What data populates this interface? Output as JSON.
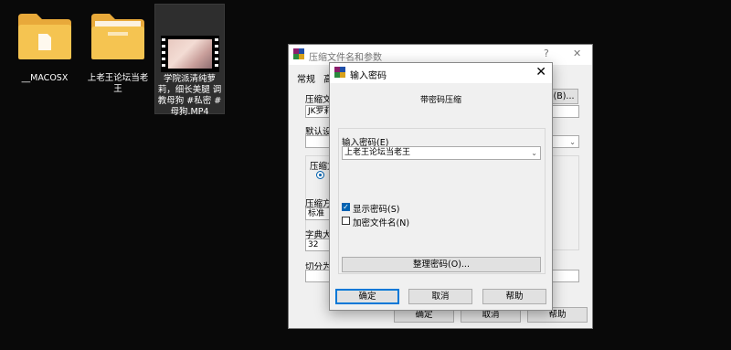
{
  "desktop": {
    "icons": [
      {
        "label": "__MACOSX"
      },
      {
        "label": "上老王论坛当老王"
      },
      {
        "label": "学院派清纯萝莉，细长美腿 调教母狗 #私密 #母狗.MP4"
      }
    ]
  },
  "back_dialog": {
    "title": "压缩文件名和参数",
    "help_glyph": "?",
    "close_glyph": "✕",
    "tabs": [
      "常规",
      "高"
    ],
    "archive_name_label": "压缩文件",
    "archive_name_value": "JK罗莉",
    "browse_label": "(B)...",
    "default_settings_label": "默认设置",
    "format_group_label": "压缩文",
    "method_label": "压缩方式",
    "method_value": "标准",
    "dict_label": "字典大小",
    "dict_value": "32",
    "split_label": "切分为分",
    "ok": "确定",
    "cancel": "取消",
    "help": "帮助"
  },
  "password_dialog": {
    "title": "输入密码",
    "close_glyph": "✕",
    "subtitle": "带密码压缩",
    "password_label": "输入密码(E)",
    "password_value": "上老王论坛当老王",
    "show_password_label": "显示密码(S)",
    "show_password_checked": true,
    "encrypt_names_label": "加密文件名(N)",
    "encrypt_names_checked": false,
    "organize_button": "整理密码(O)...",
    "ok": "确定",
    "cancel": "取消",
    "help": "帮助"
  },
  "colors": {
    "desktop_bg": "#090909",
    "accent": "#0078d7",
    "folder": "#f5c451"
  }
}
